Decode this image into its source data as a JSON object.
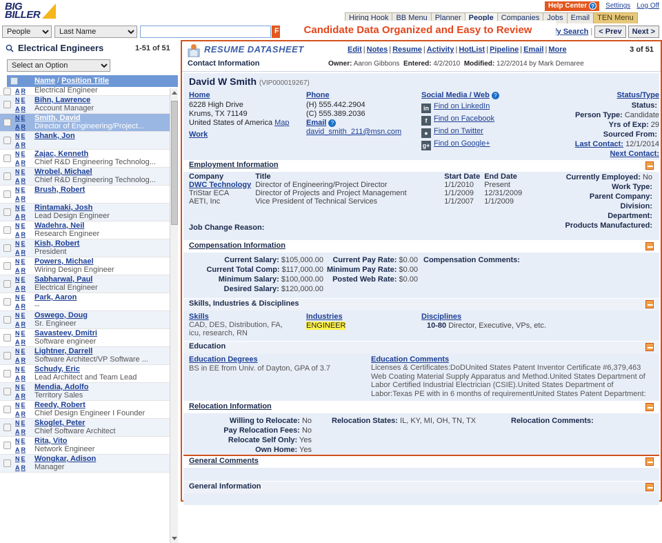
{
  "brand": {
    "line1": "BIG",
    "line2": "BILLER"
  },
  "topbar": {
    "help_center": "Help Center",
    "help_icon": "question-mark-icon",
    "settings": "Settings",
    "log_off": "Log Off",
    "tabs": [
      {
        "label": "Hiring Hook",
        "active": false
      },
      {
        "label": "BB Menu",
        "active": false
      },
      {
        "label": "Planner",
        "active": false
      },
      {
        "label": "People",
        "active": true
      },
      {
        "label": "Companies",
        "active": false
      },
      {
        "label": "Jobs",
        "active": false
      },
      {
        "label": "Email",
        "active": false
      },
      {
        "label": "TEN Menu",
        "active": false
      }
    ]
  },
  "search": {
    "module": "People",
    "field": "Last Name",
    "value": "",
    "placeholder": "",
    "find_label": "F",
    "modify_search": "ify Search",
    "prev_label": "< Prev",
    "next_label": "Next >"
  },
  "callout": {
    "text": "Candidate Data Organized and Easy to Review"
  },
  "list": {
    "title": "Electrical Engineers",
    "count": "1-51 of 51",
    "option_select": "Select an Option",
    "header_name": "Name",
    "header_sep": "/",
    "header_position": "Position Title",
    "rows": [
      {
        "name": "",
        "position": "Electrical Engineer",
        "selected": false
      },
      {
        "name": "Bihn, Lawrence",
        "position": "Account Manager",
        "selected": false
      },
      {
        "name": "Smith, David",
        "position": "Director of Engineering/Project...",
        "selected": true
      },
      {
        "name": "Shank, Jon",
        "position": "",
        "selected": false
      },
      {
        "name": "Zajac, Kenneth",
        "position": "Chief R&D Engineering Technolog...",
        "selected": false
      },
      {
        "name": "Wrobel, Michael",
        "position": "Chief R&D Engineering Technolog...",
        "selected": false
      },
      {
        "name": "Brush, Robert",
        "position": "",
        "selected": false
      },
      {
        "name": "Rintamaki, Josh",
        "position": "Lead Design Engineer",
        "selected": false
      },
      {
        "name": "Wadehra, Neil",
        "position": "Research Engineer",
        "selected": false
      },
      {
        "name": "Kish, Robert",
        "position": "President",
        "selected": false
      },
      {
        "name": "Powers, Michael",
        "position": "Wiring Design Engineer",
        "selected": false
      },
      {
        "name": "Sabharwal, Paul",
        "position": "Electrical Engineer",
        "selected": false
      },
      {
        "name": "Park, Aaron",
        "position": "--",
        "selected": false
      },
      {
        "name": "Oswego, Doug",
        "position": "Sr. Engineer",
        "selected": false
      },
      {
        "name": "Savasteev, Dmitri",
        "position": "Software engineer",
        "selected": false
      },
      {
        "name": "Lightner, Darrell",
        "position": "Software Architect/VP Software ...",
        "selected": false
      },
      {
        "name": "Schudy, Eric",
        "position": "Lead Architect and Team Lead",
        "selected": false
      },
      {
        "name": "Mendia, Adolfo",
        "position": "Territory Sales",
        "selected": false
      },
      {
        "name": "Reedy, Robert",
        "position": "Chief Design Engineer I Founder",
        "selected": false
      },
      {
        "name": "Skoglet, Peter",
        "position": "Chief Software Architect",
        "selected": false
      },
      {
        "name": "Rita, Vito",
        "position": "Network Engineer",
        "selected": false
      },
      {
        "name": "Wongkar, Adison",
        "position": "Manager",
        "selected": false
      }
    ],
    "row_letters": {
      "n": "N",
      "e": "E",
      "a": "A",
      "r": "R"
    }
  },
  "datasheet": {
    "title": "RESUME DATASHEET",
    "links": [
      "Edit",
      "Notes",
      "Resume",
      "Activity",
      "HotList",
      "Pipeline",
      "Email",
      "More"
    ],
    "record_counter": "3 of 51",
    "contact_section_label": "Contact Information",
    "owner_label": "Owner:",
    "owner_value": "Aaron Gibbons",
    "entered_label": "Entered:",
    "entered_value": "4/2/2010",
    "modified_label": "Modified:",
    "modified_value": "12/2/2014 by Mark Demaree",
    "person_name": "David W Smith",
    "person_id": "(VIP000019267)",
    "home": {
      "label": "Home",
      "street": "6228 High Drive",
      "citystate": "Krums, TX 71149",
      "country": "United States of America",
      "map_link": "Map",
      "work_label": "Work"
    },
    "phone": {
      "label": "Phone",
      "home_phone": "(H) 555.442.2904",
      "cell_phone": "(C) 555.389.2036",
      "email_label": "Email",
      "email_value": "david_smith_211@msn.com"
    },
    "social": {
      "label": "Social Media / Web",
      "items": [
        {
          "icon": "linkedin-icon",
          "glyph": "in",
          "label": "Find on LinkedIn"
        },
        {
          "icon": "facebook-icon",
          "glyph": "f",
          "label": "Find on Facebook"
        },
        {
          "icon": "twitter-icon",
          "glyph": "ᵛ",
          "label": "Find on Twitter"
        },
        {
          "icon": "googleplus-icon",
          "glyph": "g+",
          "label": "Find on Google+"
        }
      ]
    },
    "status": {
      "label": "Status/Type",
      "rows": [
        {
          "k": "Status:",
          "v": "",
          "link": false
        },
        {
          "k": "Person Type:",
          "v": "Candidate",
          "link": false
        },
        {
          "k": "Yrs of Exp:",
          "v": "29",
          "link": false
        },
        {
          "k": "Sourced From:",
          "v": "",
          "link": false
        },
        {
          "k": "Last Contact:",
          "v": "12/1/2014",
          "link": true
        },
        {
          "k": "Next Contact:",
          "v": "",
          "link": true
        }
      ]
    },
    "employment": {
      "section": "Employment Information",
      "columns": [
        "Company",
        "Title",
        "Start Date",
        "End Date"
      ],
      "rows": [
        {
          "company": "DWC Technology",
          "title": "Director of Engineering/Project Director",
          "start": "1/1/2010",
          "end": "Present",
          "link": true
        },
        {
          "company": "TriStar ECA",
          "title": "Director of Projects and Project Management",
          "start": "1/1/2009",
          "end": "12/31/2009",
          "link": false
        },
        {
          "company": "AETI, Inc",
          "title": "Vice President of Technical Services",
          "start": "1/1/2007",
          "end": "1/1/2009",
          "link": false
        }
      ],
      "job_change_reason_label": "Job Change Reason:",
      "job_change_reason_value": "",
      "side": [
        {
          "k": "Currently Employed:",
          "v": "No"
        },
        {
          "k": "Work Type:",
          "v": ""
        },
        {
          "k": "Parent Company:",
          "v": ""
        },
        {
          "k": "Division:",
          "v": ""
        },
        {
          "k": "Department:",
          "v": ""
        },
        {
          "k": "Products Manufactured:",
          "v": ""
        }
      ]
    },
    "compensation": {
      "section": "Compensation Information",
      "col1": [
        {
          "k": "Current Salary:",
          "v": "$105,000.00"
        },
        {
          "k": "Current Total Comp:",
          "v": "$117,000.00"
        },
        {
          "k": "Minimum Salary:",
          "v": "$100,000.00"
        },
        {
          "k": "Desired Salary:",
          "v": "$120,000.00"
        }
      ],
      "col2": [
        {
          "k": "Current Pay Rate:",
          "v": "$0.00"
        },
        {
          "k": "Minimum Pay Rate:",
          "v": "$0.00"
        },
        {
          "k": "Posted Web Rate:",
          "v": "$0.00"
        }
      ],
      "comments_label": "Compensation Comments:",
      "comments_value": ""
    },
    "skills": {
      "section": "Skills, Industries & Disciplines",
      "skills_label": "Skills",
      "skills_value": "CAD, DES, Distribution, FA, icu, research, RN",
      "industries_label": "Industries",
      "industries_value": "ENGINEER",
      "disciplines_label": "Disciplines",
      "disciplines_code": "10-80",
      "disciplines_value": "Director, Executive, VPs, etc."
    },
    "education": {
      "section": "Education",
      "degrees_label": "Education Degrees",
      "degrees_value": "BS in EE from Univ. of Dayton, GPA of 3.7",
      "comments_label": "Education Comments",
      "comments_value": "Licenses & Certificates:DoDUnited States Patent Inventor Certificate #6,379,463 Web Coating Material Supply Apparatus and Method.United States Department of Labor Certified Industrial Electrician (CSIE).United States Department of Labor:Texas PE with in 6 months of requirementUnited States Patent Department:"
    },
    "relocation": {
      "section": "Relocation Information",
      "col1": [
        {
          "k": "Willing to Relocate:",
          "v": "No"
        },
        {
          "k": "Pay Relocation Fees:",
          "v": "No"
        },
        {
          "k": "Relocate Self Only:",
          "v": "Yes"
        },
        {
          "k": "Own Home:",
          "v": "Yes"
        }
      ],
      "states_label": "Relocation States:",
      "states_value": "IL, KY, MI, OH, TN, TX",
      "comments_label": "Relocation Comments:",
      "comments_value": ""
    },
    "general_comments": {
      "section": "General Comments",
      "value": ""
    },
    "general_information": {
      "section": "General Information"
    }
  }
}
